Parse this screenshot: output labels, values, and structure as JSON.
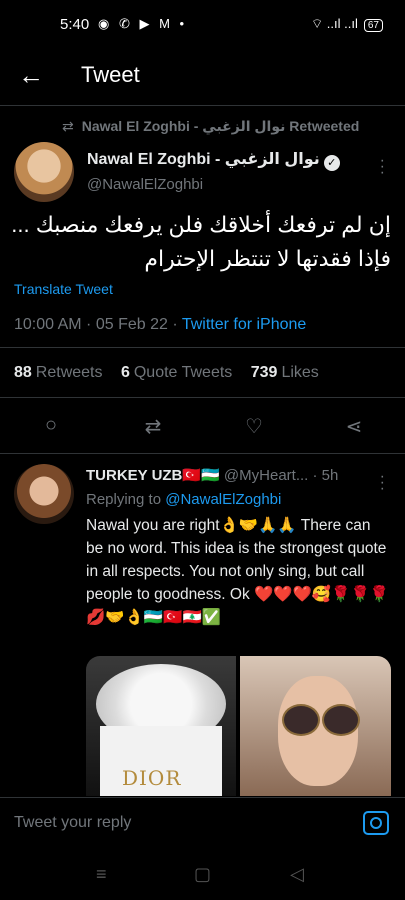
{
  "status": {
    "time": "5:40",
    "notif": "◉ ✆ ▶ M •",
    "signal": "⌔ ..ıl ..ıl",
    "battery": "67"
  },
  "header": {
    "title": "Tweet",
    "back": "←"
  },
  "tweet": {
    "retweet_label": "Nawal El Zoghbi - نوال الزغبي Retweeted",
    "author_name": "Nawal El Zoghbi - نوال الزغبي",
    "handle": "@NawalElZoghbi",
    "text_line1": "إن لم ترفعك أخلاقك فلن يرفعك منصبك ...",
    "text_line2": "فإذا فقدتها لا تنتظر الإحترام",
    "translate": "Translate Tweet",
    "time": "10:00 AM · 05 Feb 22 · ",
    "source": "Twitter for iPhone",
    "retweets": "88",
    "retweets_label": "Retweets",
    "quotes": "6",
    "quotes_label": "Quote Tweets",
    "likes": "739",
    "likes_label": "Likes"
  },
  "actions": {
    "reply": "○",
    "retweet": "⇄",
    "like": "♡",
    "share": "⋖"
  },
  "reply": {
    "name": "TURKEY UZB🇹🇷🇺🇿",
    "handle": " @MyHeart...",
    "time": " · 5h",
    "replying_to": "Replying to ",
    "replying_handle": "@NawalElZoghbi",
    "text": "Nawal you are right👌🤝🙏🙏 There can be no word. This idea is the strongest quote in all respects. You not only sing, but call people to goodness. Ok ❤️❤️❤️🥰🌹🌹🌹💋🤝👌🇺🇿🇹🇷🇱🇧✅",
    "image_text": "DIOR"
  },
  "composer": {
    "placeholder": "Tweet your reply"
  },
  "navbar": {
    "menu": "≡",
    "home": "▢",
    "back": "◁"
  }
}
